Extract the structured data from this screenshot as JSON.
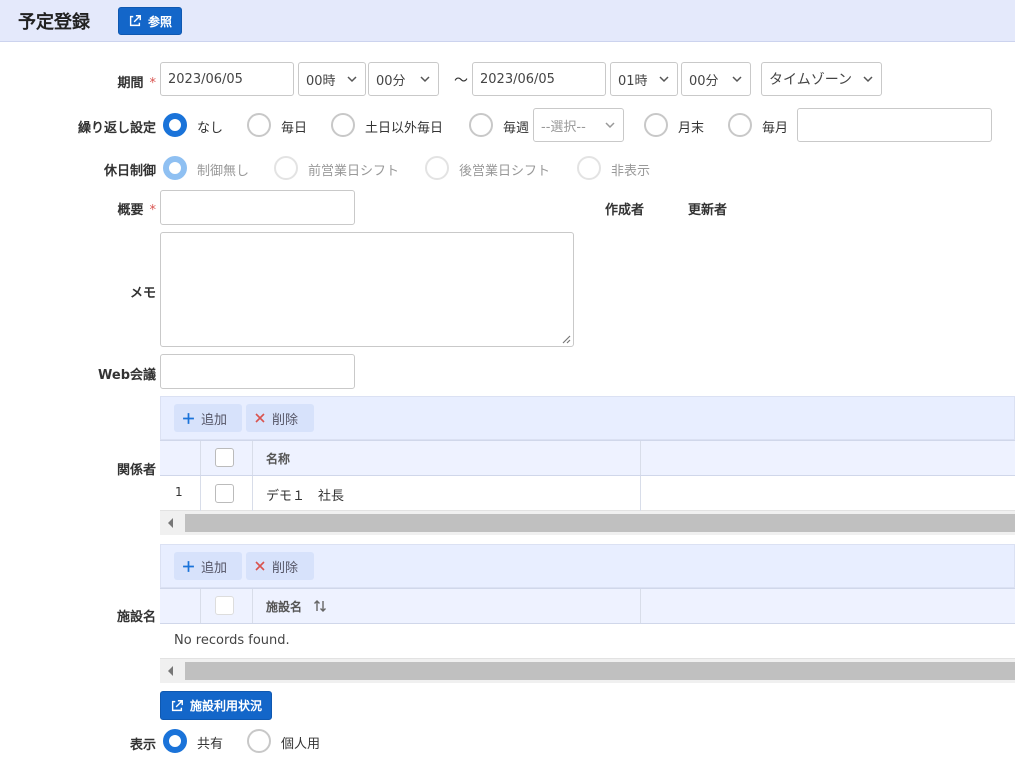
{
  "header": {
    "title": "予定登録",
    "ref_button": "参照"
  },
  "period": {
    "label": "期間",
    "required_mark": "*",
    "start_date": "2023/06/05",
    "start_hour": "00時",
    "start_min": "00分",
    "tilde": "～",
    "end_date": "2023/06/05",
    "end_hour": "01時",
    "end_min": "00分",
    "timezone": "タイムゾーン"
  },
  "repeat": {
    "label": "繰り返し設定",
    "options": [
      "なし",
      "毎日",
      "土日以外毎日",
      "毎週",
      "月末",
      "毎月"
    ],
    "selected": "なし",
    "week_select": "--選択--"
  },
  "holiday": {
    "label": "休日制御",
    "options": [
      "制御無し",
      "前営業日シフト",
      "後営業日シフト",
      "非表示"
    ],
    "selected": "制御無し"
  },
  "summary": {
    "label": "概要",
    "required_mark": "*"
  },
  "creator_label": "作成者",
  "updater_label": "更新者",
  "memo": {
    "label": "メモ"
  },
  "web_meeting": {
    "label": "Web会議"
  },
  "participants": {
    "label": "関係者",
    "add": "追加",
    "delete": "削除",
    "column_name": "名称",
    "rows": [
      {
        "no": "1",
        "name": "デモ１　社長"
      }
    ]
  },
  "facilities": {
    "label": "施設名",
    "add": "追加",
    "delete": "削除",
    "column_name": "施設名",
    "empty": "No records found."
  },
  "facility_usage_button": "施設利用状況",
  "display": {
    "label": "表示",
    "options": [
      "共有",
      "個人用"
    ],
    "selected": "共有"
  },
  "colors": {
    "primary": "#1366c9",
    "radio_on": "#1a73d9",
    "header_bg": "#e4e9fb",
    "required": "#d9534f",
    "delete": "#d9534f"
  }
}
